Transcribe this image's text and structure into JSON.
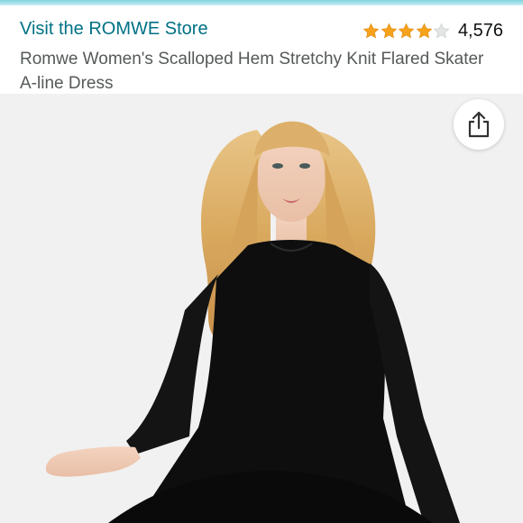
{
  "header": {
    "store_link": "Visit the ROMWE Store",
    "rating": {
      "stars": 4,
      "max_stars": 5,
      "count": "4,576",
      "star_color": "#f7a21b",
      "empty_star_color": "#d5d9d9"
    }
  },
  "product": {
    "title": "Romwe Women's Scalloped Hem Stretchy Knit Flared Skater A-line Dress"
  },
  "image": {
    "background": "#f1f1f1"
  },
  "share": {
    "icon": "share-icon"
  }
}
